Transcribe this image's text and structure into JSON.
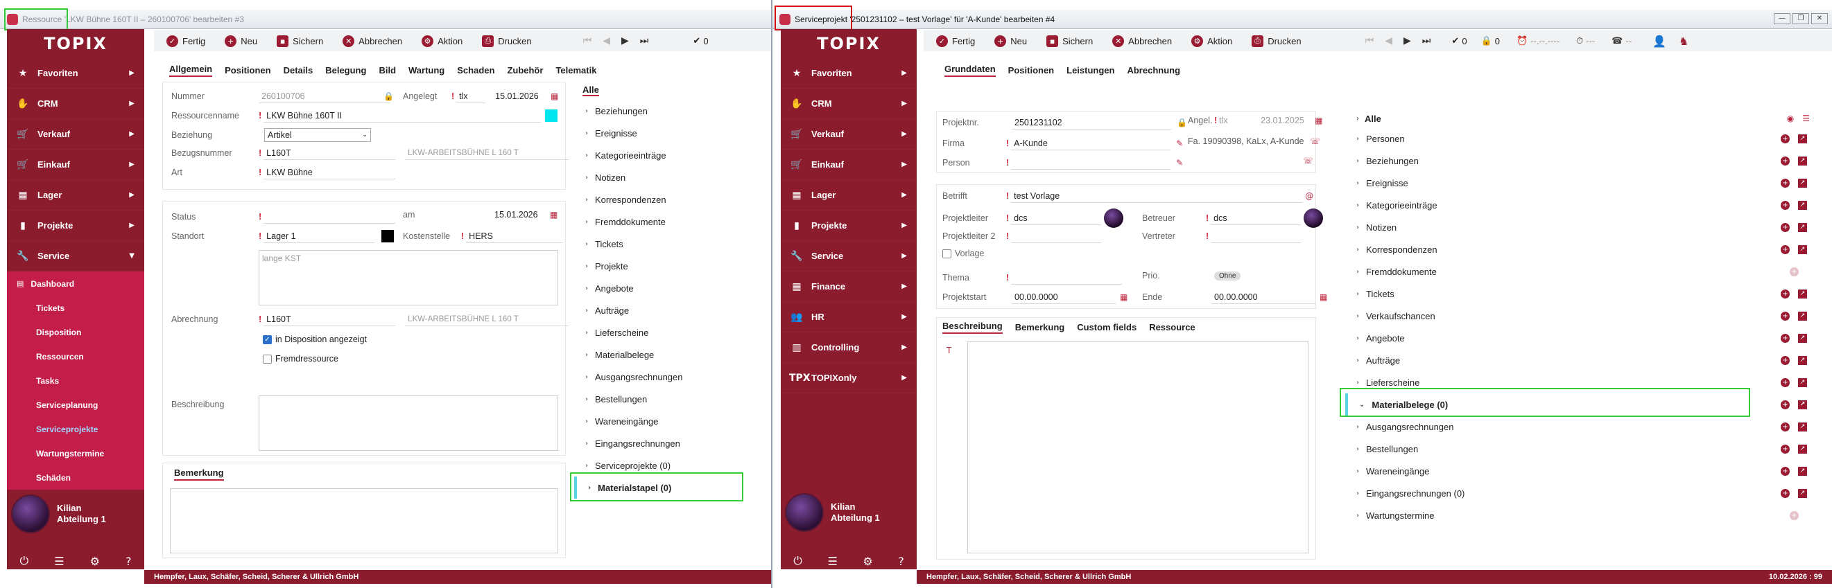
{
  "colors": {
    "sidebar": "#8b1c2d",
    "submenu": "#c31d4a",
    "accent": "#b9233c",
    "highlight_green": "#33cc33",
    "highlight_red": "#d01010",
    "cyan_swatch": "#00e5ee"
  },
  "win1": {
    "title": "Ressource 'LKW Bühne 160T II – 260100706' bearbeiten #3",
    "logo": "TOPIX",
    "nav": [
      {
        "icon": "star-icon",
        "glyph": "★",
        "label": "Favoriten"
      },
      {
        "icon": "handshake-icon",
        "glyph": "✋",
        "label": "CRM"
      },
      {
        "icon": "sales-icon",
        "glyph": "🛒",
        "label": "Verkauf"
      },
      {
        "icon": "cart-icon",
        "glyph": "🛒",
        "label": "Einkauf"
      },
      {
        "icon": "warehouse-icon",
        "glyph": "▦",
        "label": "Lager"
      },
      {
        "icon": "folder-icon",
        "glyph": "▮",
        "label": "Projekte"
      },
      {
        "icon": "wrench-icon",
        "glyph": "🔧",
        "label": "Service"
      }
    ],
    "sub": [
      "Dashboard",
      "Tickets",
      "Disposition",
      "Ressourcen",
      "Tasks",
      "Serviceplanung",
      "Serviceprojekte",
      "Wartungstermine",
      "Schäden"
    ],
    "user": {
      "name": "Kilian",
      "dept": "Abteilung 1"
    },
    "toolbar": {
      "fertig": "Fertig",
      "neu": "Neu",
      "sichern": "Sichern",
      "abbrechen": "Abbrechen",
      "aktion": "Aktion",
      "drucken": "Drucken",
      "count": "0"
    },
    "tabs": [
      "Allgemein",
      "Positionen",
      "Details",
      "Belegung",
      "Bild",
      "Wartung",
      "Schaden",
      "Zubehör",
      "Telematik"
    ],
    "form": {
      "nummer_l": "Nummer",
      "nummer": "260100706",
      "angelegt_l": "Angelegt",
      "angelegt_by": "tlx",
      "angelegt_date": "15.01.2026",
      "ressourcenname_l": "Ressourcenname",
      "ressourcenname": "LKW Bühne 160T II",
      "beziehung_l": "Beziehung",
      "beziehung": "Artikel",
      "bezugsnummer_l": "Bezugsnummer",
      "bezugsnummer": "L160T",
      "bezugsnummer_desc": "LKW-ARBEITSBÜHNE L 160 T",
      "art_l": "Art",
      "art": "LKW Bühne",
      "status_l": "Status",
      "am_l": "am",
      "am_date": "15.01.2026",
      "standort_l": "Standort",
      "standort": "Lager 1",
      "kostenstelle_l": "Kostenstelle",
      "kostenstelle": "HERS",
      "kst_placeholder": "lange KST",
      "abrechnung_l": "Abrechnung",
      "abrechnung": "L160T",
      "abrechnung_desc": "LKW-ARBEITSBÜHNE L 160 T",
      "in_dispo": "in Disposition angezeigt",
      "fremd": "Fremdressource",
      "beschreibung_l": "Beschreibung",
      "bemerkung_tab": "Bemerkung"
    },
    "list_header": "Alle",
    "list": [
      "Beziehungen",
      "Ereignisse",
      "Kategorieeinträge",
      "Notizen",
      "Korrespondenzen",
      "Fremddokumente",
      "Tickets",
      "Projekte",
      "Angebote",
      "Aufträge",
      "Lieferscheine",
      "Materialbelege",
      "Ausgangsrechnungen",
      "Bestellungen",
      "Wareneingänge",
      "Eingangsrechnungen",
      "Serviceprojekte (0)",
      "Materialstapel (0)"
    ],
    "footer": "Hempfer, Laux, Schäfer, Scheid, Scherer & Ullrich GmbH"
  },
  "win2": {
    "title": "Serviceprojekt '2501231102 – test Vorlage' für 'A-Kunde' bearbeiten #4",
    "logo": "TOPIX",
    "nav": [
      {
        "icon": "star-icon",
        "glyph": "★",
        "label": "Favoriten"
      },
      {
        "icon": "handshake-icon",
        "glyph": "✋",
        "label": "CRM"
      },
      {
        "icon": "sales-icon",
        "glyph": "🛒",
        "label": "Verkauf"
      },
      {
        "icon": "cart-icon",
        "glyph": "🛒",
        "label": "Einkauf"
      },
      {
        "icon": "warehouse-icon",
        "glyph": "▦",
        "label": "Lager"
      },
      {
        "icon": "folder-icon",
        "glyph": "▮",
        "label": "Projekte"
      },
      {
        "icon": "wrench-icon",
        "glyph": "🔧",
        "label": "Service"
      },
      {
        "icon": "grid-icon",
        "glyph": "▦",
        "label": "Finance"
      },
      {
        "icon": "people-icon",
        "glyph": "👥",
        "label": "HR"
      },
      {
        "icon": "chart-icon",
        "glyph": "▥",
        "label": "Controlling"
      },
      {
        "icon": "tpx-icon",
        "glyph": "TPX",
        "label": "TOPIXonly"
      }
    ],
    "user": {
      "name": "Kilian",
      "dept": "Abteilung 1"
    },
    "toolbar": {
      "fertig": "Fertig",
      "neu": "Neu",
      "sichern": "Sichern",
      "abbrechen": "Abbrechen",
      "aktion": "Aktion",
      "drucken": "Drucken",
      "check_count": "0",
      "lock_count": "0",
      "time1": "--.--.----",
      "time2": "---",
      "time3": "--"
    },
    "tabs": [
      "Grunddaten",
      "Positionen",
      "Leistungen",
      "Abrechnung"
    ],
    "form": {
      "projektnr_l": "Projektnr.",
      "projektnr": "2501231102",
      "angel_l": "Angel.",
      "angel_by": "tlx",
      "angel_date": "23.01.2025",
      "firma_l": "Firma",
      "firma": "A-Kunde",
      "firma_info": "Fa. 19090398, KaLx, A-Kunde",
      "person_l": "Person",
      "betrifft_l": "Betrifft",
      "betrifft": "test Vorlage",
      "projektleiter_l": "Projektleiter",
      "projektleiter": "dcs",
      "betreuer_l": "Betreuer",
      "betreuer": "dcs",
      "projektleiter2_l": "Projektleiter 2",
      "vertreter_l": "Vertreter",
      "vorlage": "Vorlage",
      "thema_l": "Thema",
      "prio_l": "Prio.",
      "prio": "Ohne",
      "projektstart_l": "Projektstart",
      "projektstart": "00.00.0000",
      "ende_l": "Ende",
      "ende": "00.00.0000"
    },
    "subtabs": [
      "Beschreibung",
      "Bemerkung",
      "Custom fields",
      "Ressource"
    ],
    "list_header": "Alle",
    "list": [
      "Personen",
      "Beziehungen",
      "Ereignisse",
      "Kategorieeinträge",
      "Notizen",
      "Korrespondenzen",
      "Fremddokumente",
      "Tickets",
      "Verkaufschancen",
      "Angebote",
      "Aufträge",
      "Lieferscheine",
      "Materialbelege (0)",
      "Ausgangsrechnungen",
      "Bestellungen",
      "Wareneingänge",
      "Eingangsrechnungen (0)",
      "Wartungstermine"
    ],
    "footer": "Hempfer, Laux, Schäfer, Scheid, Scherer & Ullrich GmbH",
    "footer_right": "10.02.2026 : 99"
  }
}
